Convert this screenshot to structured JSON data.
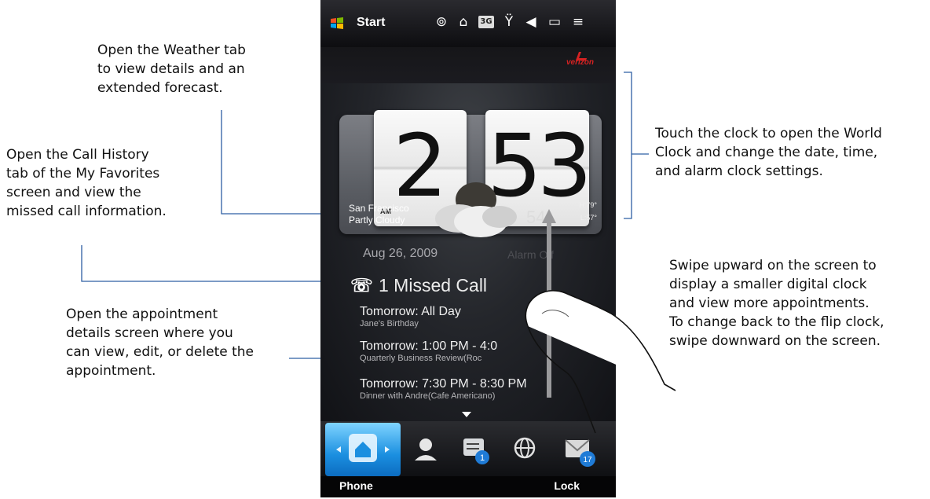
{
  "callouts": {
    "weather_tab": [
      "Open the Weather tab",
      "to view details and an",
      "extended forecast."
    ],
    "call_history": [
      "Open the Call History",
      "tab of the My Favorites",
      "screen and view the",
      "missed call information."
    ],
    "appointment": [
      "Open the appointment",
      "details screen where you",
      "can view, edit, or delete the",
      "appointment."
    ],
    "world_clock": [
      "Touch the clock to open the World",
      "Clock and change the date, time,",
      "and alarm clock settings."
    ],
    "swipe": [
      "Swipe upward on the screen to",
      "display a smaller digital clock",
      "and view more appointments.",
      "To change back to the flip clock,",
      "swipe downward on the screen."
    ]
  },
  "status_bar": {
    "start_label": "Start",
    "icons": [
      "messenger-icon",
      "tv-icon",
      "3g-icon",
      "signal-icon",
      "volume-icon",
      "battery-icon",
      "menu-icon"
    ],
    "network_badge": "3G"
  },
  "carrier": {
    "name": "verizon",
    "color": "#d52222"
  },
  "clock": {
    "hour": "2",
    "minutes": "53",
    "ampm": "AM",
    "city": "San Francisco",
    "condition": "Partly Cloudy",
    "temperature": "54",
    "high": "H:79°",
    "low": "L:57°"
  },
  "date": "Aug 26, 2009",
  "alarm": "Alarm Off",
  "missed_call": "1 Missed Call",
  "appointments": [
    {
      "title": "Tomorrow: All Day",
      "subtitle": "Jane's Birthday"
    },
    {
      "title": "Tomorrow: 1:00 PM - 4:0",
      "subtitle": "Quarterly Business Review(Roc"
    },
    {
      "title": "Tomorrow: 7:30 PM - 8:30 PM",
      "subtitle": "Dinner with Andre(Cafe Americano)"
    }
  ],
  "tabs": [
    {
      "icon": "home-icon",
      "active": true
    },
    {
      "icon": "person-icon"
    },
    {
      "icon": "messages-icon",
      "badge": "1"
    },
    {
      "icon": "globe-icon"
    },
    {
      "icon": "mail-icon",
      "badge": "17"
    }
  ],
  "softkeys": {
    "left": "Phone",
    "right": "Lock"
  },
  "colors": {
    "callout_line": "#2e5fa3",
    "active_tab": "#1b8fe0"
  }
}
